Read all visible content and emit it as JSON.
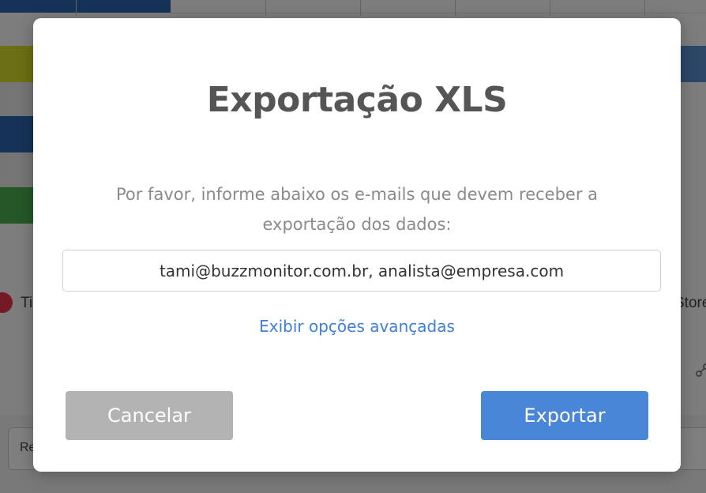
{
  "background": {
    "left_legend_text": "Ti",
    "right_legend_text": "Store",
    "bottom_input_text": "Re"
  },
  "modal": {
    "title": "Exportação XLS",
    "description": "Por favor, informe abaixo os e-mails que devem receber a exportação dos dados:",
    "email_value": "tami@buzzmonitor.com.br, analista@empresa.com",
    "advanced_link": "Exibir opções avançadas",
    "cancel_label": "Cancelar",
    "export_label": "Exportar"
  },
  "colors": {
    "export_button": "#4a86d8",
    "cancel_button": "#b3b3b3",
    "link": "#3f7fd6",
    "title": "#555555"
  },
  "icons": {
    "background_share": "share-icon"
  }
}
